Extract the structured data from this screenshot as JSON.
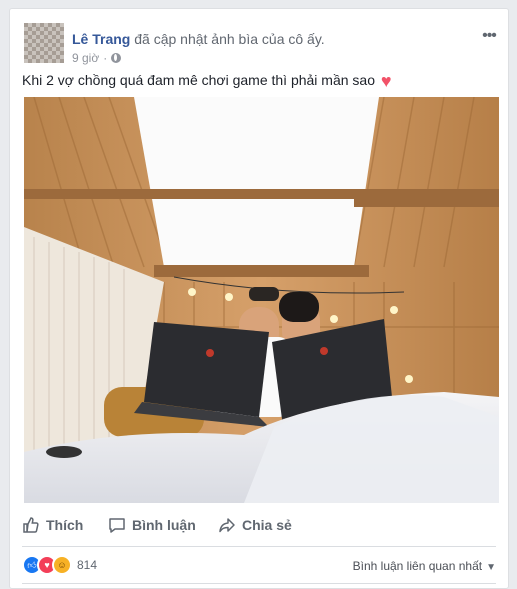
{
  "post": {
    "author": "Lê Trang",
    "action": "đã cập nhật ảnh bìa của cô ấy.",
    "time": "9 giờ",
    "more_icon": "ellipsis-icon",
    "caption": "Khi 2 vợ chồng quá đam mê chơi game thì phải mần sao",
    "caption_emoji": "heart-emoji",
    "photo": "couple-kissing-with-laptops-photo"
  },
  "actions": {
    "like": "Thích",
    "comment": "Bình luận",
    "share": "Chia sẻ"
  },
  "reactions": {
    "types": [
      "like",
      "love",
      "haha"
    ],
    "count": "814",
    "colors": {
      "like": "#1877f2",
      "love": "#f33e58",
      "haha": "#f7b125"
    }
  },
  "comments": {
    "sort_label": "Bình luận liên quan nhất"
  }
}
